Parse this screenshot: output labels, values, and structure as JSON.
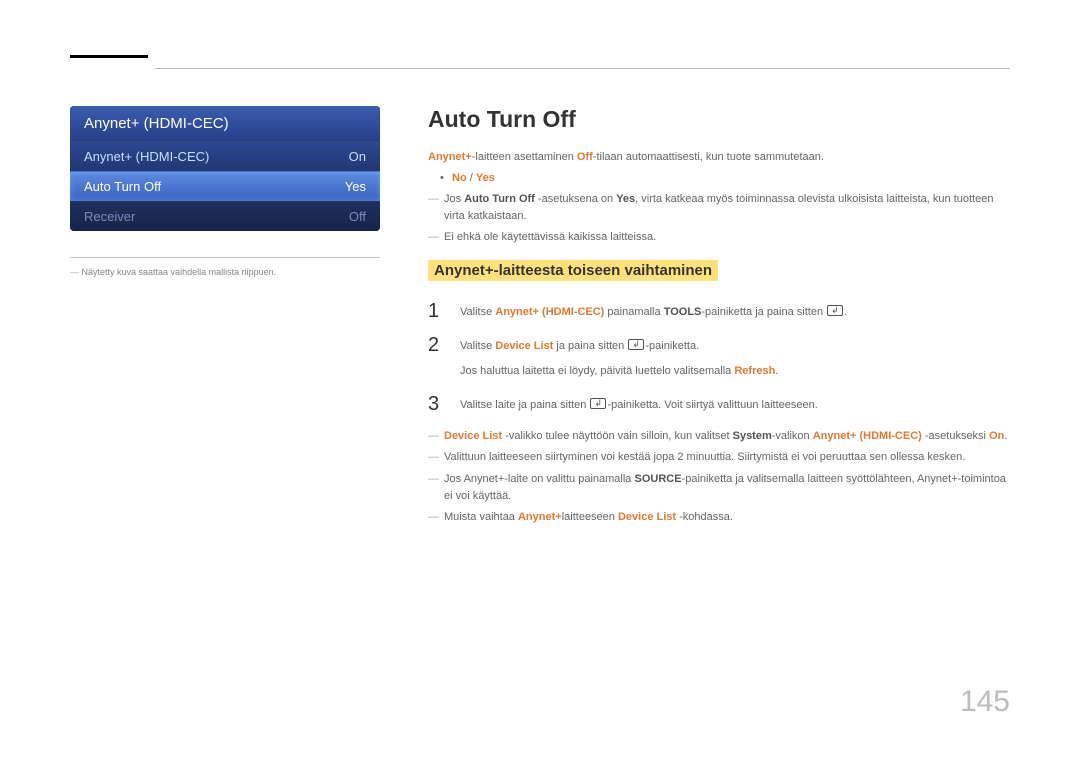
{
  "menu": {
    "title": "Anynet+ (HDMI-CEC)",
    "rows": [
      {
        "label": "Anynet+ (HDMI-CEC)",
        "value": "On"
      },
      {
        "label": "Auto Turn Off",
        "value": "Yes"
      },
      {
        "label": "Receiver",
        "value": "Off"
      }
    ]
  },
  "left_note": "Näytetty kuva saattaa vaihdella mallista riippuen.",
  "section_title": "Auto Turn Off",
  "intro": {
    "pre": "Anynet+",
    "mid": "-laitteen asettaminen ",
    "off": "Off",
    "post": "-tilaan automaattisesti, kun tuote sammutetaan."
  },
  "noyes": {
    "no": "No",
    "sep": " / ",
    "yes": "Yes"
  },
  "note1": {
    "a": "Jos ",
    "b": "Auto Turn Off",
    "c": " -asetuksena on ",
    "d": "Yes",
    "e": ", virta katkeaa myös toiminnassa olevista ulkoisista laitteista, kun tuotteen virta katkaistaan."
  },
  "note2": "Ei ehkä ole käytettävissä kaikissa laitteissa.",
  "sub_heading": "Anynet+-laitteesta toiseen vaihtaminen",
  "steps": {
    "s1": {
      "a": "Valitse ",
      "b": "Anynet+ (HDMI-CEC)",
      "c": " painamalla ",
      "d": "TOOLS",
      "e": "-painiketta ja paina sitten ",
      "f": "."
    },
    "s2": {
      "a": "Valitse ",
      "b": "Device List",
      "c": " ja paina sitten ",
      "d": "-painiketta.",
      "sub_a": "Jos haluttua laitetta ei löydy, päivitä luettelo valitsemalla ",
      "sub_b": "Refresh",
      "sub_c": "."
    },
    "s3": {
      "a": "Valitse laite ja paina sitten ",
      "b": "-painiketta. Voit siirtyä valittuun laitteeseen."
    }
  },
  "after": {
    "d1": {
      "a": "Device List",
      "b": " -valikko tulee näyttöön vain silloin, kun valitset ",
      "c": "System",
      "d": "-valikon ",
      "e": "Anynet+ (HDMI-CEC)",
      "f": " -asetukseksi ",
      "g": "On",
      "h": "."
    },
    "d2": "Valittuun laitteeseen siirtyminen voi kestää jopa 2 minuuttia. Siirtymistä ei voi peruuttaa sen ollessa kesken.",
    "d3": {
      "a": "Jos Anynet+-laite on valittu painamalla ",
      "b": "SOURCE",
      "c": "-painiketta ja valitsemalla laitteen syöttölähteen, Anynet+-toimintoa ei voi käyttää."
    },
    "d4": {
      "a": "Muista vaihtaa ",
      "b": "Anynet+",
      "c": "laitteeseen ",
      "d": "Device List",
      "e": " -kohdassa."
    }
  },
  "page_number": "145"
}
